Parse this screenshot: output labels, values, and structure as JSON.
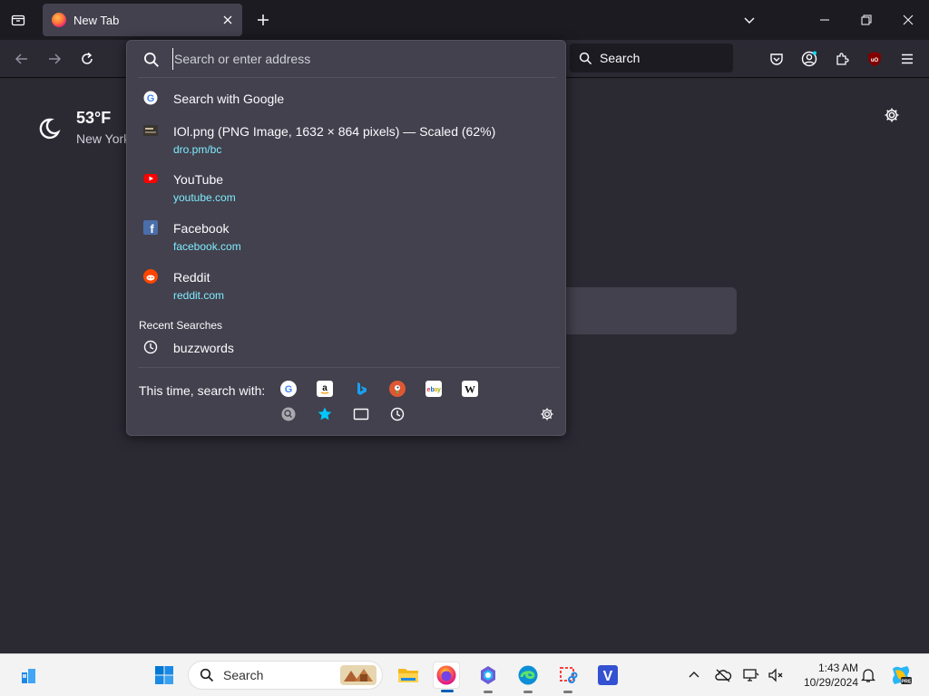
{
  "tabs": {
    "list_all_icon": "list-all-tabs-icon",
    "active_tab_title": "New Tab",
    "new_tab_icon": "plus-icon"
  },
  "window": {
    "controls": [
      "minimize",
      "restore",
      "close"
    ]
  },
  "toolbar": {
    "search_label": "Search"
  },
  "urlbar": {
    "placeholder": "Search or enter address",
    "results": [
      {
        "title": "Search with Google",
        "url": "",
        "icon": "google-icon"
      },
      {
        "title": "IOl.png (PNG Image, 1632 × 864 pixels) — Scaled (62%)",
        "url": "dro.pm/bc",
        "icon": "image-thumbnail-icon"
      },
      {
        "title": "YouTube",
        "url": "youtube.com",
        "icon": "youtube-icon"
      },
      {
        "title": "Facebook",
        "url": "facebook.com",
        "icon": "facebook-icon"
      },
      {
        "title": "Reddit",
        "url": "reddit.com",
        "icon": "reddit-icon"
      }
    ],
    "recent_label": "Recent Searches",
    "recent": [
      {
        "title": "buzzwords",
        "icon": "history-icon"
      }
    ],
    "oneoff_label": "This time, search with:",
    "engines": [
      "google",
      "amazon",
      "bing",
      "duckduckgo",
      "ebay",
      "wikipedia",
      "search-mode",
      "bookmarks",
      "tabs",
      "history"
    ]
  },
  "newtab": {
    "temperature": "53°F",
    "location": "New York"
  },
  "taskbar": {
    "search_label": "Search",
    "time": "1:43 AM",
    "date": "10/29/2024"
  },
  "colors": {
    "chrome_bg": "#1c1b22",
    "content_bg": "#2b2a33",
    "panel_bg": "#42414d",
    "link": "#80ebff",
    "taskbar_bg": "#f3f3f3",
    "accent": "#005fb8"
  }
}
